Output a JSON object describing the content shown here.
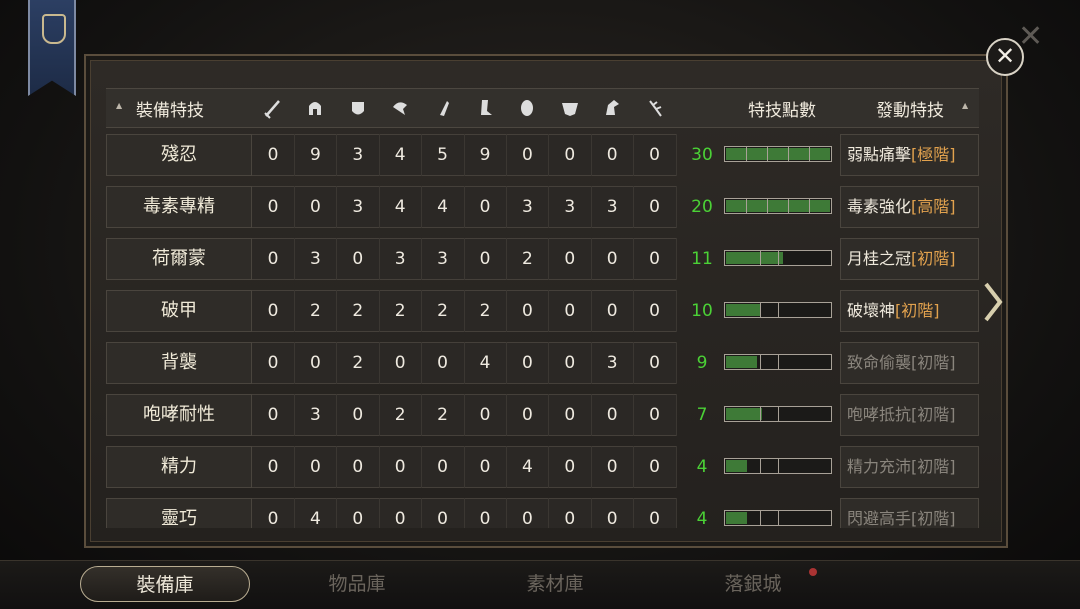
{
  "header": {
    "skill_col": "裝備特技",
    "points_col": "特技點數",
    "active_col": "發動特技",
    "equipment_icons": [
      "sword-icon",
      "helmet-icon",
      "chest-armor-icon",
      "gauntlet-icon",
      "arm-guard-icon",
      "boots-icon",
      "charm-icon",
      "mask-icon",
      "horse-icon",
      "branch-icon"
    ]
  },
  "rows": [
    {
      "name": "殘忍",
      "values": [
        "0",
        "9",
        "3",
        "4",
        "5",
        "9",
        "0",
        "0",
        "0",
        "0"
      ],
      "points": "30",
      "level": 1.0,
      "active": "弱點痛擊",
      "tier": "[極階]",
      "dim": false
    },
    {
      "name": "毒素專精",
      "values": [
        "0",
        "0",
        "3",
        "4",
        "4",
        "0",
        "3",
        "3",
        "3",
        "0"
      ],
      "points": "20",
      "level": 1.0,
      "active": "毒素強化",
      "tier": "[高階]",
      "dim": false
    },
    {
      "name": "荷爾蒙",
      "values": [
        "0",
        "3",
        "0",
        "3",
        "3",
        "0",
        "2",
        "0",
        "0",
        "0"
      ],
      "points": "11",
      "level": 0.55,
      "active": "月桂之冠",
      "tier": "[初階]",
      "dim": false
    },
    {
      "name": "破甲",
      "values": [
        "0",
        "2",
        "2",
        "2",
        "2",
        "2",
        "0",
        "0",
        "0",
        "0"
      ],
      "points": "10",
      "level": 0.33,
      "active": "破壞神",
      "tier": "[初階]",
      "dim": false
    },
    {
      "name": "背襲",
      "values": [
        "0",
        "0",
        "2",
        "0",
        "0",
        "4",
        "0",
        "0",
        "3",
        "0"
      ],
      "points": "9",
      "level": 0.3,
      "active": "致命偷襲",
      "tier": "[初階]",
      "dim": true
    },
    {
      "name": "咆哮耐性",
      "values": [
        "0",
        "3",
        "0",
        "2",
        "2",
        "0",
        "0",
        "0",
        "0",
        "0"
      ],
      "points": "7",
      "level": 0.35,
      "active": "咆哮抵抗",
      "tier": "[初階]",
      "dim": true
    },
    {
      "name": "精力",
      "values": [
        "0",
        "0",
        "0",
        "0",
        "0",
        "0",
        "4",
        "0",
        "0",
        "0"
      ],
      "points": "4",
      "level": 0.2,
      "active": "精力充沛",
      "tier": "[初階]",
      "dim": true
    },
    {
      "name": "靈巧",
      "values": [
        "0",
        "4",
        "0",
        "0",
        "0",
        "0",
        "0",
        "0",
        "0",
        "0"
      ],
      "points": "4",
      "level": 0.2,
      "active": "閃避高手",
      "tier": "[初階]",
      "dim": true
    }
  ],
  "tabs": [
    {
      "label": "裝備庫",
      "active": true
    },
    {
      "label": "物品庫",
      "active": false
    },
    {
      "label": "素材庫",
      "active": false
    },
    {
      "label": "落銀城",
      "active": false
    }
  ],
  "colors": {
    "points_green": "#4bd136",
    "bar_fill": "#3e7a37",
    "tier_orange": "#e2a24e"
  }
}
